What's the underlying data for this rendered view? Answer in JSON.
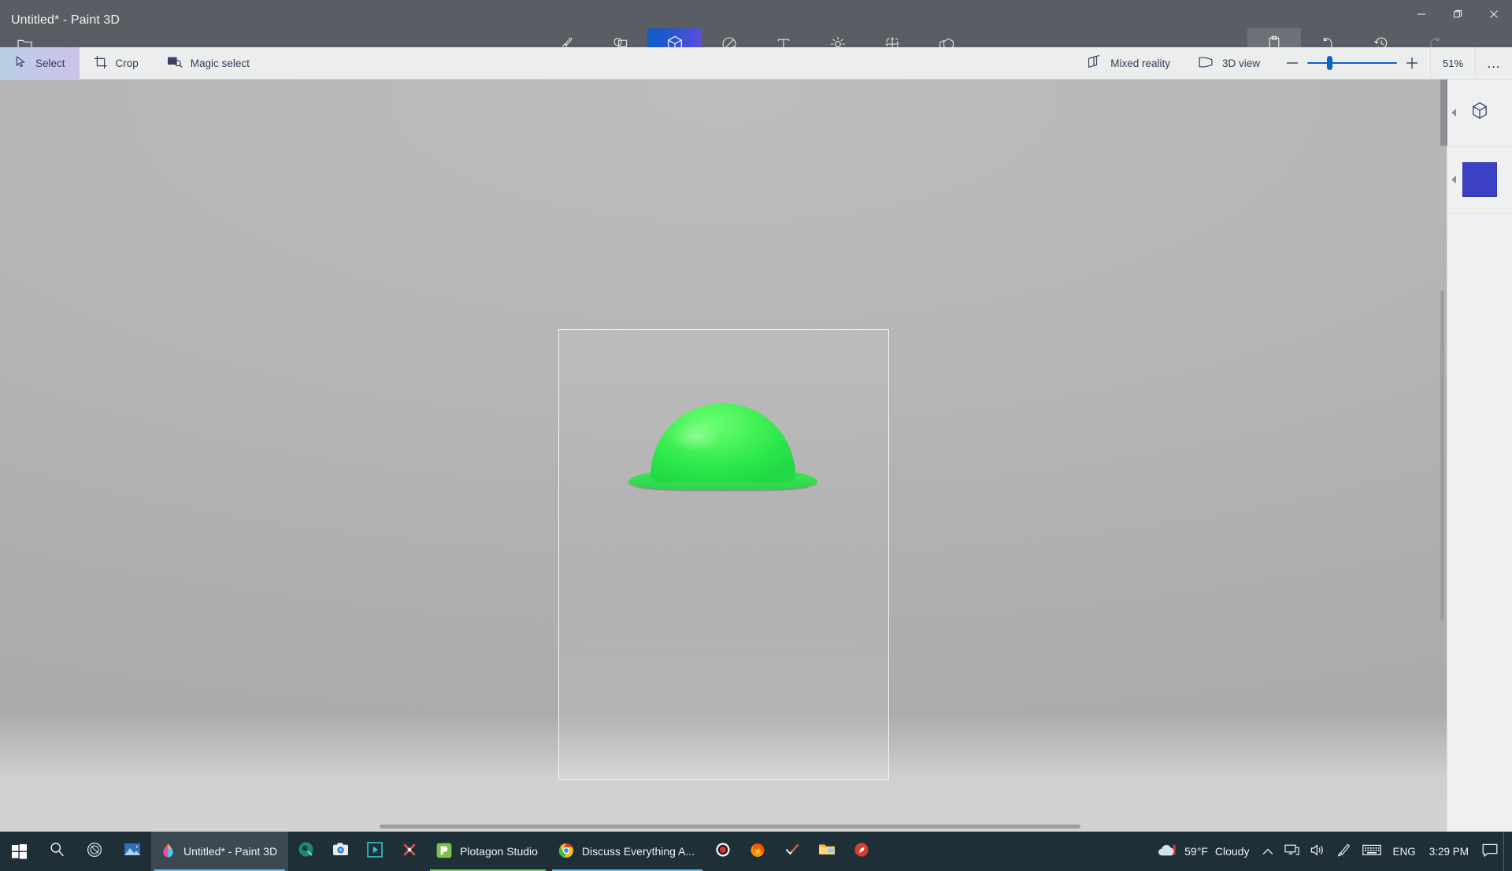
{
  "window": {
    "title": "Untitled* - Paint 3D",
    "controls": {
      "minimize": "minimize-icon",
      "maximize": "maximize-icon",
      "close": "close-icon"
    }
  },
  "menu": {
    "label": "Menu",
    "icon": "folder-icon"
  },
  "tabs": [
    {
      "label": "Brushes",
      "icon": "brush-icon",
      "active": false
    },
    {
      "label": "2D shapes",
      "icon": "2d-shapes-icon",
      "active": false
    },
    {
      "label": "3D shapes",
      "icon": "cube-icon",
      "active": true
    },
    {
      "label": "Stickers",
      "icon": "sticker-icon",
      "active": false
    },
    {
      "label": "Text",
      "icon": "text-icon",
      "active": false
    },
    {
      "label": "Effects",
      "icon": "effects-icon",
      "active": false
    },
    {
      "label": "Canvas",
      "icon": "canvas-icon",
      "active": false
    },
    {
      "label": "3D library",
      "icon": "3d-library-icon",
      "active": false
    }
  ],
  "title_actions": [
    {
      "label": "Paste",
      "icon": "clipboard-icon",
      "state": "hovered"
    },
    {
      "label": "Undo",
      "icon": "undo-icon",
      "state": "enabled"
    },
    {
      "label": "History",
      "icon": "history-icon",
      "state": "enabled"
    },
    {
      "label": "Redo",
      "icon": "redo-icon",
      "state": "disabled"
    }
  ],
  "collapse_ribbon": {
    "icon": "chevron-up-icon"
  },
  "ribbon": {
    "left_tools": [
      {
        "label": "Select",
        "icon": "cursor-select-icon",
        "selected": true
      },
      {
        "label": "Crop",
        "icon": "crop-icon",
        "selected": false
      },
      {
        "label": "Magic select",
        "icon": "magic-select-icon",
        "selected": false
      }
    ],
    "right_tools": [
      {
        "label": "Mixed reality",
        "icon": "mixed-reality-icon"
      },
      {
        "label": "3D view",
        "icon": "3d-view-icon"
      }
    ],
    "zoom": {
      "minus": "minus-icon",
      "plus": "plus-icon",
      "percent": "51%",
      "value": 51,
      "min": 0,
      "max": 200,
      "thumb_position_pct": 23
    },
    "more": "…"
  },
  "canvas": {
    "object": {
      "name": "green-3d-hat-object",
      "color": "#35e64e"
    },
    "sheet_border_color": "#f3f3f3"
  },
  "rail": {
    "sections": [
      {
        "name": "3d-objects-panel",
        "icon": "cube-icon"
      },
      {
        "name": "color-swatch-panel",
        "swatch": "#3c40c4"
      }
    ]
  },
  "taskbar": {
    "start": "windows-start-icon",
    "search": "search-icon",
    "cortana": "cortana-icon",
    "pinned": [
      {
        "name": "photos-icon"
      }
    ],
    "apps": [
      {
        "label": "Untitled* - Paint 3D",
        "icon": "paint3d-icon",
        "state": "active"
      }
    ],
    "tray_pinned": [
      {
        "name": "firefox-nightly-icon"
      },
      {
        "name": "camera-icon"
      },
      {
        "name": "movies-tv-icon"
      },
      {
        "name": "app-icon"
      }
    ],
    "apps2": [
      {
        "label": "Plotagon Studio",
        "icon": "plotagon-icon",
        "state": "open"
      },
      {
        "label": "Discuss Everything A...",
        "icon": "chrome-icon",
        "state": "open"
      }
    ],
    "tray_pinned2": [
      {
        "name": "record-icon"
      },
      {
        "name": "firefox-icon"
      },
      {
        "name": "checkmark-icon"
      },
      {
        "name": "file-explorer-icon"
      },
      {
        "name": "app2-icon"
      }
    ],
    "system": {
      "weather_temp": "59°F",
      "weather_cond": "Cloudy",
      "overflow": "chevron-up-icon",
      "network": "network-icon",
      "volume": "volume-icon",
      "pen": "pen-icon",
      "keyboard": "keyboard-icon",
      "language": "ENG",
      "time": "3:29 PM",
      "action_center": "notification-icon"
    }
  }
}
